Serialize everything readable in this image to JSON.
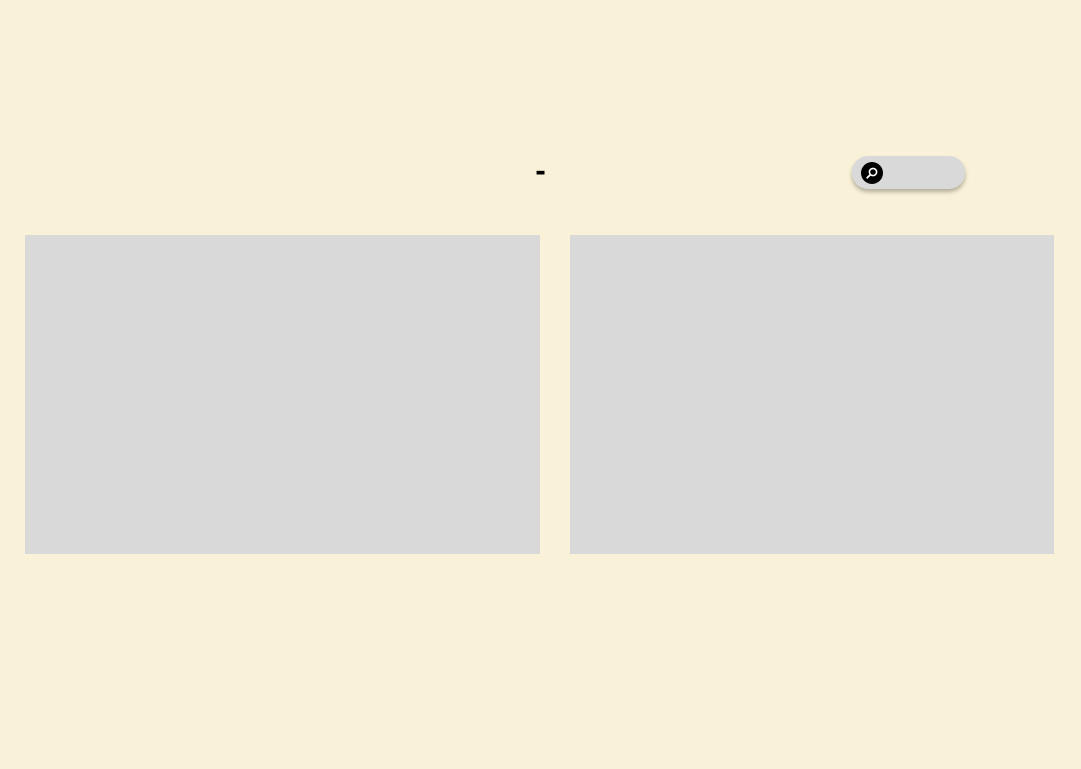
{
  "header": {
    "title": "-"
  },
  "search": {
    "icon": "search-icon",
    "value": "",
    "placeholder": ""
  },
  "colors": {
    "background": "#f9f2d8",
    "panel": "#d9d9d9",
    "search_bar": "#d9d9d9",
    "search_icon_bg": "#000000",
    "text": "#000000"
  }
}
